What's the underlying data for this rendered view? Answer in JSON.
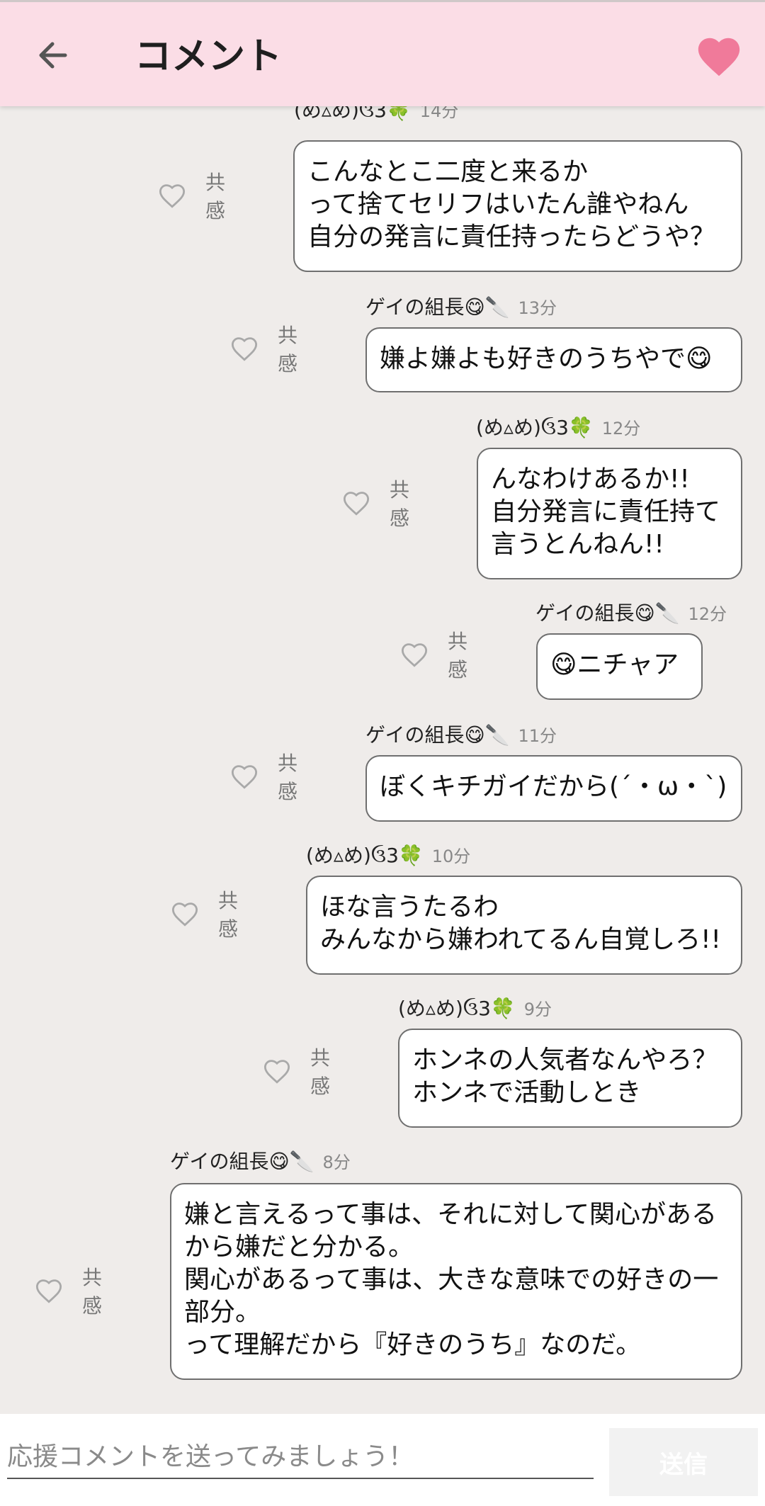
{
  "appbar": {
    "title": "コメント"
  },
  "like_label": "共感",
  "messages": [
    {
      "author": "(め▵め)ઉ3🍀",
      "time": "14分",
      "text": "こんなとこ二度と来るか\nって捨てセリフはいたん誰やねん\n自分の発言に責任持ったらどうや？"
    },
    {
      "author": "ゲイの組長😋🔪",
      "time": "13分",
      "text": "嫌よ嫌よも好きのうちやで😋"
    },
    {
      "author": "(め▵め)ઉ3🍀",
      "time": "12分",
      "text": "んなわけあるか!!\n自分発言に責任持て\n言うとんねん!!"
    },
    {
      "author": "ゲイの組長😋🔪",
      "time": "12分",
      "text": "😋ニチャア"
    },
    {
      "author": "ゲイの組長😋🔪",
      "time": "11分",
      "text": "ぼくキチガイだから(´・ω・`)"
    },
    {
      "author": "(め▵め)ઉ3🍀",
      "time": "10分",
      "text": "ほな言うたるわ\nみんなから嫌われてるん自覚しろ!!"
    },
    {
      "author": "(め▵め)ઉ3🍀",
      "time": "9分",
      "text": "ホンネの人気者なんやろ？\nホンネで活動しとき"
    },
    {
      "author": "ゲイの組長😋🔪",
      "time": "8分",
      "text": "嫌と言えるって事は、それに対して関心があるから嫌だと分かる。\n関心があるって事は、大きな意味での好きの一部分。\nって理解だから『好きのうち』なのだ。"
    }
  ],
  "composer": {
    "placeholder": "応援コメントを送ってみましょう！",
    "send_label": "送信"
  }
}
